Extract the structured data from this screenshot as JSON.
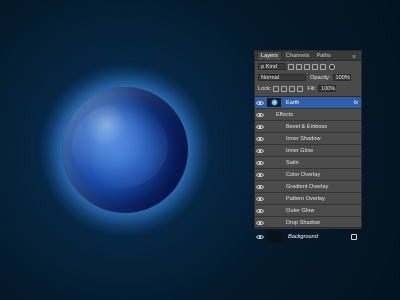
{
  "scene": {
    "background": "#03121f",
    "glow": "#3c96ff"
  },
  "panel": {
    "tabs": [
      {
        "label": "Layers",
        "active": true
      },
      {
        "label": "Channels",
        "active": false
      },
      {
        "label": "Paths",
        "active": false
      }
    ],
    "menu_icon": "panel-menu",
    "search": {
      "label": "ρ Kind"
    },
    "blend": {
      "mode": "Normal",
      "opacity_label": "Opacity:",
      "opacity_value": "100%"
    },
    "locks": {
      "label": "Lock:",
      "fill_label": "Fill:",
      "fill_value": "100%"
    },
    "layers": [
      {
        "name": "Earth",
        "selected": true,
        "has_fx": true,
        "fx_label": "fx"
      },
      {
        "name": "Effects",
        "type": "effects-header"
      },
      {
        "name": "Bevel & Emboss",
        "type": "effect"
      },
      {
        "name": "Inner Shadow",
        "type": "effect"
      },
      {
        "name": "Inner Glow",
        "type": "effect"
      },
      {
        "name": "Satin",
        "type": "effect"
      },
      {
        "name": "Color Overlay",
        "type": "effect"
      },
      {
        "name": "Gradient Overlay",
        "type": "effect"
      },
      {
        "name": "Pattern Overlay",
        "type": "effect"
      },
      {
        "name": "Outer Glow",
        "type": "effect"
      },
      {
        "name": "Drop Shadow",
        "type": "effect"
      },
      {
        "name": "Background",
        "type": "background"
      }
    ]
  }
}
